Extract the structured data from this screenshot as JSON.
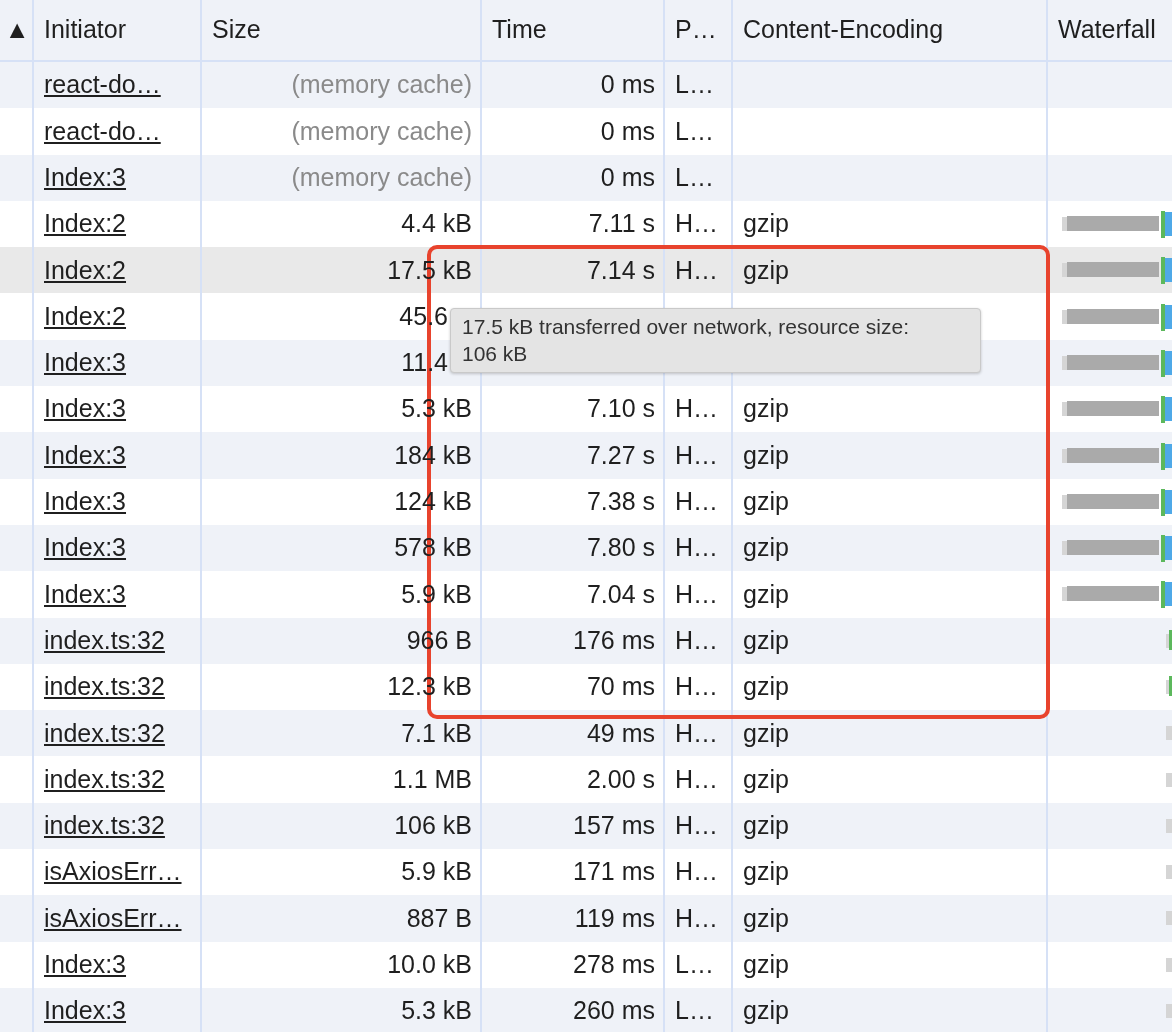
{
  "columns": [
    "▲",
    "Initiator",
    "Size",
    "Time",
    "P…",
    "Content-Encoding",
    "Waterfall"
  ],
  "rows": [
    {
      "initiator": "react-do…",
      "size": "(memory cache)",
      "cached": true,
      "time": "0 ms",
      "protocol": "L…",
      "encoding": "",
      "hovered": false
    },
    {
      "initiator": "react-do…",
      "size": "(memory cache)",
      "cached": true,
      "time": "0 ms",
      "protocol": "L…",
      "encoding": "",
      "hovered": false
    },
    {
      "initiator": "Index:3",
      "size": "(memory cache)",
      "cached": true,
      "time": "0 ms",
      "protocol": "L…",
      "encoding": "",
      "hovered": false
    },
    {
      "initiator": "Index:2",
      "size": "4.4 kB",
      "cached": false,
      "time": "7.11 s",
      "protocol": "H…",
      "encoding": "gzip",
      "hovered": false,
      "kind": "long"
    },
    {
      "initiator": "Index:2",
      "size": "17.5 kB",
      "cached": false,
      "time": "7.14 s",
      "protocol": "H…",
      "encoding": "gzip",
      "hovered": true,
      "kind": "long"
    },
    {
      "initiator": "Index:2",
      "size": "45.6",
      "size_cut": true,
      "cached": false,
      "time": "",
      "protocol": "",
      "encoding": "",
      "hovered": false,
      "kind": "long"
    },
    {
      "initiator": "Index:3",
      "size": "11.4",
      "size_cut": true,
      "cached": false,
      "time": "",
      "protocol": "",
      "encoding": "",
      "hovered": false,
      "kind": "long"
    },
    {
      "initiator": "Index:3",
      "size": "5.3 kB",
      "cached": false,
      "time": "7.10 s",
      "protocol": "H…",
      "encoding": "gzip",
      "hovered": false,
      "kind": "long"
    },
    {
      "initiator": "Index:3",
      "size": "184 kB",
      "cached": false,
      "time": "7.27 s",
      "protocol": "H…",
      "encoding": "gzip",
      "hovered": false,
      "kind": "long"
    },
    {
      "initiator": "Index:3",
      "size": "124 kB",
      "cached": false,
      "time": "7.38 s",
      "protocol": "H…",
      "encoding": "gzip",
      "hovered": false,
      "kind": "long"
    },
    {
      "initiator": "Index:3",
      "size": "578 kB",
      "cached": false,
      "time": "7.80 s",
      "protocol": "H…",
      "encoding": "gzip",
      "hovered": false,
      "kind": "long"
    },
    {
      "initiator": "Index:3",
      "size": "5.9 kB",
      "cached": false,
      "time": "7.04 s",
      "protocol": "H…",
      "encoding": "gzip",
      "hovered": false,
      "kind": "long"
    },
    {
      "initiator": "index.ts:32",
      "size": "966 B",
      "cached": false,
      "time": "176 ms",
      "protocol": "H…",
      "encoding": "gzip",
      "hovered": false,
      "kind": "short"
    },
    {
      "initiator": "index.ts:32",
      "size": "12.3 kB",
      "cached": false,
      "time": "70 ms",
      "protocol": "H…",
      "encoding": "gzip",
      "hovered": false,
      "kind": "short"
    },
    {
      "initiator": "index.ts:32",
      "size": "7.1 kB",
      "cached": false,
      "time": "49 ms",
      "protocol": "H…",
      "encoding": "gzip",
      "hovered": false,
      "kind": "tick"
    },
    {
      "initiator": "index.ts:32",
      "size": "1.1 MB",
      "cached": false,
      "time": "2.00 s",
      "protocol": "H…",
      "encoding": "gzip",
      "hovered": false,
      "kind": "tick"
    },
    {
      "initiator": "index.ts:32",
      "size": "106 kB",
      "cached": false,
      "time": "157 ms",
      "protocol": "H…",
      "encoding": "gzip",
      "hovered": false,
      "kind": "tick"
    },
    {
      "initiator": "isAxiosErr…",
      "size": "5.9 kB",
      "cached": false,
      "time": "171 ms",
      "protocol": "H…",
      "encoding": "gzip",
      "hovered": false,
      "kind": "tick"
    },
    {
      "initiator": "isAxiosErr…",
      "size": "887 B",
      "cached": false,
      "time": "119 ms",
      "protocol": "H…",
      "encoding": "gzip",
      "hovered": false,
      "kind": "tick"
    },
    {
      "initiator": "Index:3",
      "size": "10.0 kB",
      "cached": false,
      "time": "278 ms",
      "protocol": "L…",
      "encoding": "gzip",
      "hovered": false,
      "kind": "tick"
    },
    {
      "initiator": "Index:3",
      "size": "5.3 kB",
      "cached": false,
      "time": "260 ms",
      "protocol": "L…",
      "encoding": "gzip",
      "hovered": false,
      "kind": "tick"
    }
  ],
  "tooltip": {
    "text": "17.5 kB transferred over network, resource size: 106 kB"
  },
  "highlight": {
    "shown": true
  }
}
